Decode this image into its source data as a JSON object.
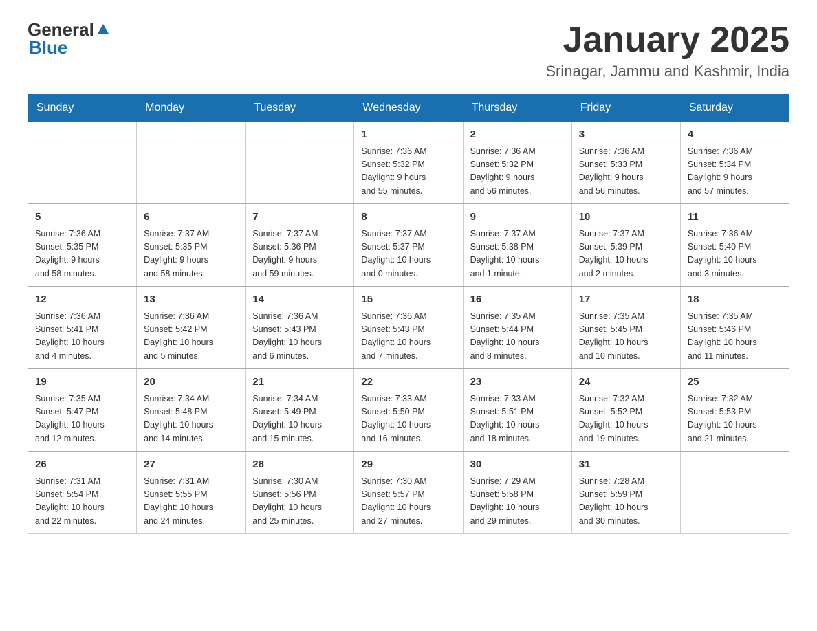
{
  "header": {
    "logo_general": "General",
    "logo_blue": "Blue",
    "month_title": "January 2025",
    "location": "Srinagar, Jammu and Kashmir, India"
  },
  "days_of_week": [
    "Sunday",
    "Monday",
    "Tuesday",
    "Wednesday",
    "Thursday",
    "Friday",
    "Saturday"
  ],
  "weeks": [
    [
      {
        "day": "",
        "info": ""
      },
      {
        "day": "",
        "info": ""
      },
      {
        "day": "",
        "info": ""
      },
      {
        "day": "1",
        "info": "Sunrise: 7:36 AM\nSunset: 5:32 PM\nDaylight: 9 hours\nand 55 minutes."
      },
      {
        "day": "2",
        "info": "Sunrise: 7:36 AM\nSunset: 5:32 PM\nDaylight: 9 hours\nand 56 minutes."
      },
      {
        "day": "3",
        "info": "Sunrise: 7:36 AM\nSunset: 5:33 PM\nDaylight: 9 hours\nand 56 minutes."
      },
      {
        "day": "4",
        "info": "Sunrise: 7:36 AM\nSunset: 5:34 PM\nDaylight: 9 hours\nand 57 minutes."
      }
    ],
    [
      {
        "day": "5",
        "info": "Sunrise: 7:36 AM\nSunset: 5:35 PM\nDaylight: 9 hours\nand 58 minutes."
      },
      {
        "day": "6",
        "info": "Sunrise: 7:37 AM\nSunset: 5:35 PM\nDaylight: 9 hours\nand 58 minutes."
      },
      {
        "day": "7",
        "info": "Sunrise: 7:37 AM\nSunset: 5:36 PM\nDaylight: 9 hours\nand 59 minutes."
      },
      {
        "day": "8",
        "info": "Sunrise: 7:37 AM\nSunset: 5:37 PM\nDaylight: 10 hours\nand 0 minutes."
      },
      {
        "day": "9",
        "info": "Sunrise: 7:37 AM\nSunset: 5:38 PM\nDaylight: 10 hours\nand 1 minute."
      },
      {
        "day": "10",
        "info": "Sunrise: 7:37 AM\nSunset: 5:39 PM\nDaylight: 10 hours\nand 2 minutes."
      },
      {
        "day": "11",
        "info": "Sunrise: 7:36 AM\nSunset: 5:40 PM\nDaylight: 10 hours\nand 3 minutes."
      }
    ],
    [
      {
        "day": "12",
        "info": "Sunrise: 7:36 AM\nSunset: 5:41 PM\nDaylight: 10 hours\nand 4 minutes."
      },
      {
        "day": "13",
        "info": "Sunrise: 7:36 AM\nSunset: 5:42 PM\nDaylight: 10 hours\nand 5 minutes."
      },
      {
        "day": "14",
        "info": "Sunrise: 7:36 AM\nSunset: 5:43 PM\nDaylight: 10 hours\nand 6 minutes."
      },
      {
        "day": "15",
        "info": "Sunrise: 7:36 AM\nSunset: 5:43 PM\nDaylight: 10 hours\nand 7 minutes."
      },
      {
        "day": "16",
        "info": "Sunrise: 7:35 AM\nSunset: 5:44 PM\nDaylight: 10 hours\nand 8 minutes."
      },
      {
        "day": "17",
        "info": "Sunrise: 7:35 AM\nSunset: 5:45 PM\nDaylight: 10 hours\nand 10 minutes."
      },
      {
        "day": "18",
        "info": "Sunrise: 7:35 AM\nSunset: 5:46 PM\nDaylight: 10 hours\nand 11 minutes."
      }
    ],
    [
      {
        "day": "19",
        "info": "Sunrise: 7:35 AM\nSunset: 5:47 PM\nDaylight: 10 hours\nand 12 minutes."
      },
      {
        "day": "20",
        "info": "Sunrise: 7:34 AM\nSunset: 5:48 PM\nDaylight: 10 hours\nand 14 minutes."
      },
      {
        "day": "21",
        "info": "Sunrise: 7:34 AM\nSunset: 5:49 PM\nDaylight: 10 hours\nand 15 minutes."
      },
      {
        "day": "22",
        "info": "Sunrise: 7:33 AM\nSunset: 5:50 PM\nDaylight: 10 hours\nand 16 minutes."
      },
      {
        "day": "23",
        "info": "Sunrise: 7:33 AM\nSunset: 5:51 PM\nDaylight: 10 hours\nand 18 minutes."
      },
      {
        "day": "24",
        "info": "Sunrise: 7:32 AM\nSunset: 5:52 PM\nDaylight: 10 hours\nand 19 minutes."
      },
      {
        "day": "25",
        "info": "Sunrise: 7:32 AM\nSunset: 5:53 PM\nDaylight: 10 hours\nand 21 minutes."
      }
    ],
    [
      {
        "day": "26",
        "info": "Sunrise: 7:31 AM\nSunset: 5:54 PM\nDaylight: 10 hours\nand 22 minutes."
      },
      {
        "day": "27",
        "info": "Sunrise: 7:31 AM\nSunset: 5:55 PM\nDaylight: 10 hours\nand 24 minutes."
      },
      {
        "day": "28",
        "info": "Sunrise: 7:30 AM\nSunset: 5:56 PM\nDaylight: 10 hours\nand 25 minutes."
      },
      {
        "day": "29",
        "info": "Sunrise: 7:30 AM\nSunset: 5:57 PM\nDaylight: 10 hours\nand 27 minutes."
      },
      {
        "day": "30",
        "info": "Sunrise: 7:29 AM\nSunset: 5:58 PM\nDaylight: 10 hours\nand 29 minutes."
      },
      {
        "day": "31",
        "info": "Sunrise: 7:28 AM\nSunset: 5:59 PM\nDaylight: 10 hours\nand 30 minutes."
      },
      {
        "day": "",
        "info": ""
      }
    ]
  ]
}
